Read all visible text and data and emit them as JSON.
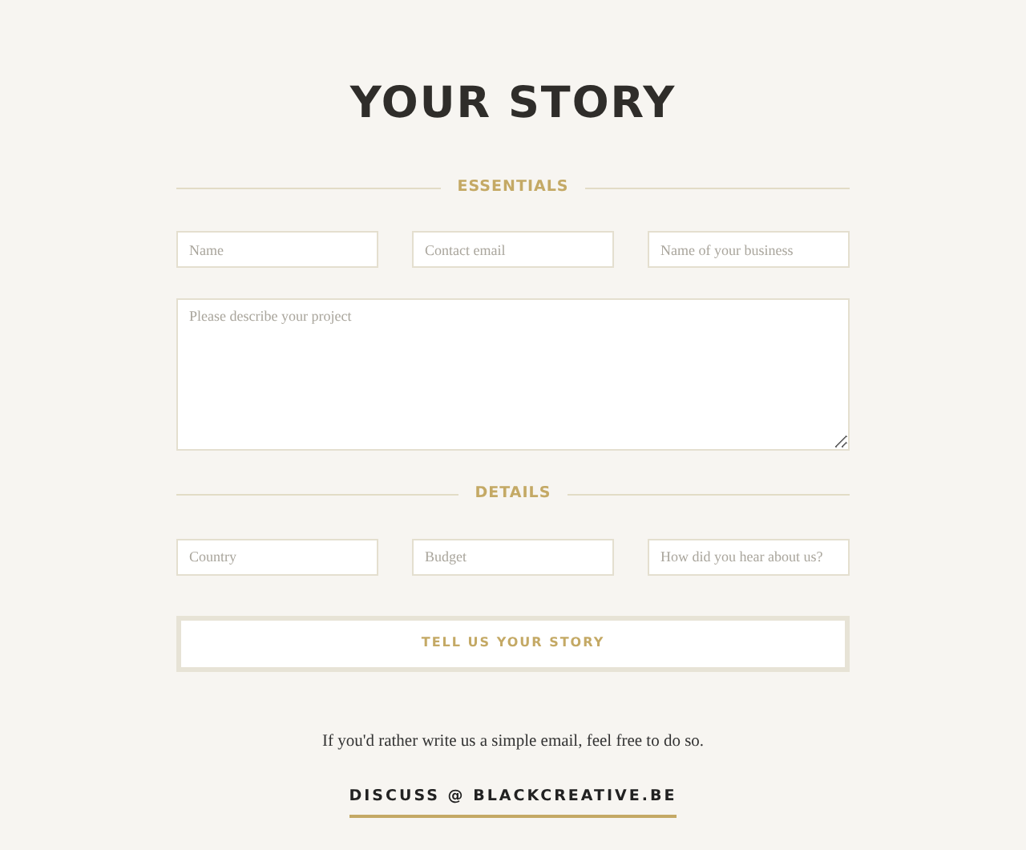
{
  "title": "YOUR STORY",
  "sections": [
    {
      "heading": "ESSENTIALS",
      "fields": [
        {
          "kind": "input",
          "placeholder": "Name"
        },
        {
          "kind": "input",
          "placeholder": "Contact email"
        },
        {
          "kind": "input",
          "placeholder": "Name of your business"
        },
        {
          "kind": "textarea",
          "placeholder": "Please describe your project"
        }
      ]
    },
    {
      "heading": "DETAILS",
      "fields": [
        {
          "kind": "input",
          "placeholder": "Country"
        },
        {
          "kind": "input",
          "placeholder": "Budget"
        },
        {
          "kind": "input",
          "placeholder": "How did you hear about us?"
        }
      ]
    }
  ],
  "submit_button": "TELL US YOUR STORY",
  "email_note": "If you'd rather write us a simple email, feel free to do so.",
  "email_link": "DISCUSS @ BLACKCREATIVE.BE"
}
